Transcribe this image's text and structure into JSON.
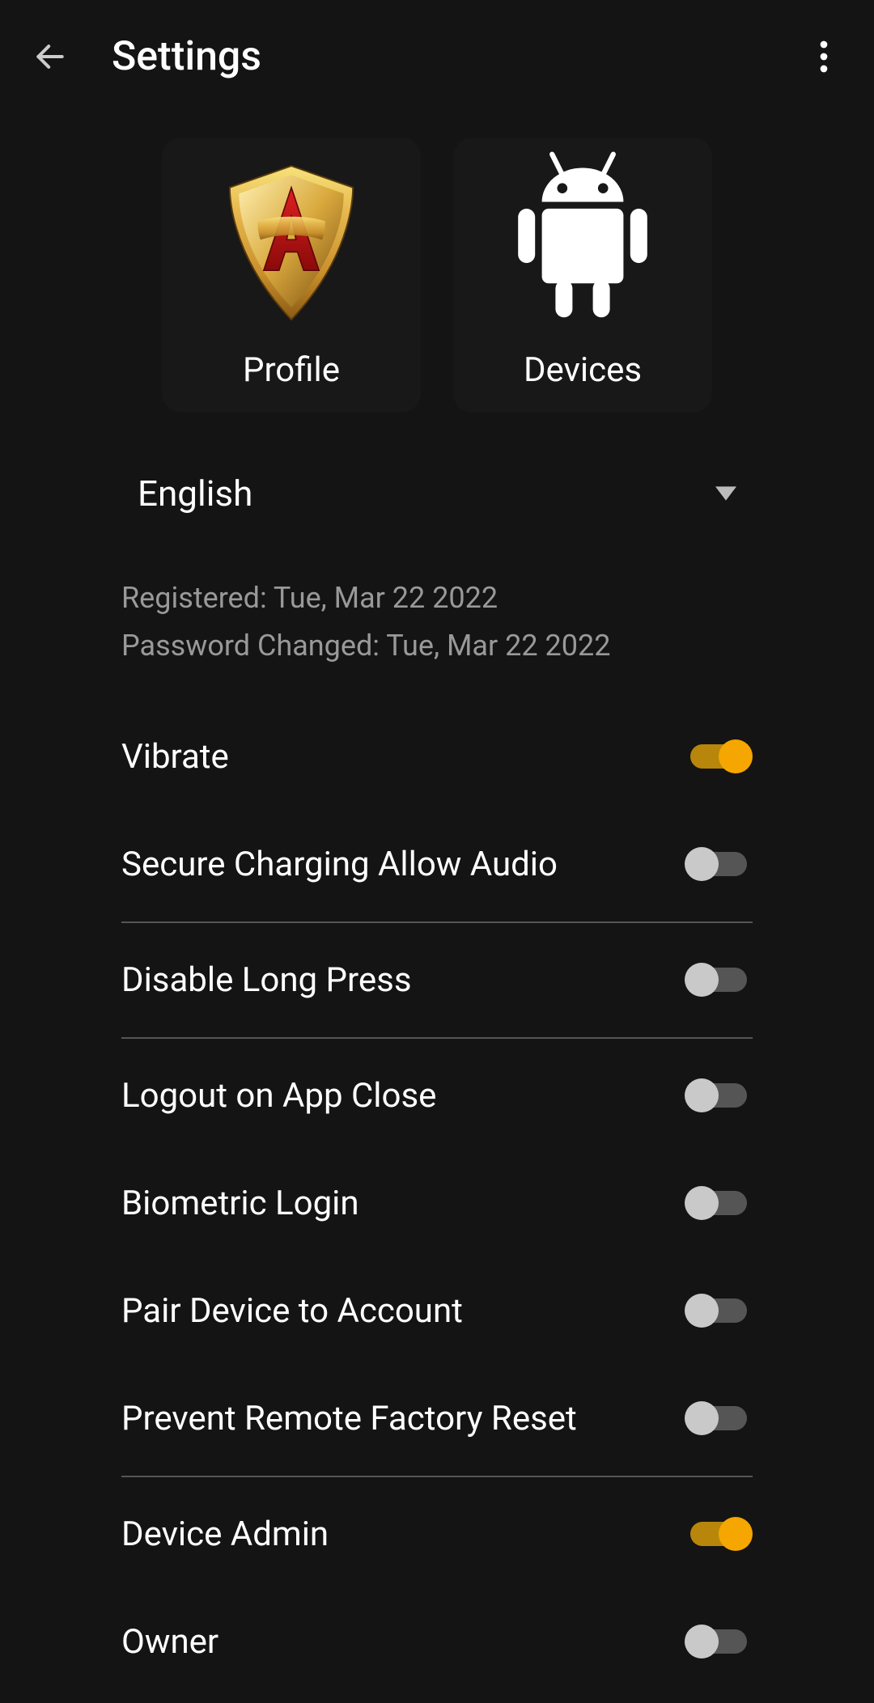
{
  "header": {
    "title": "Settings"
  },
  "cards": {
    "profile": "Profile",
    "devices": "Devices"
  },
  "language": {
    "selected": "English"
  },
  "info": {
    "registered_label": "Registered: ",
    "registered_value": "Tue, Mar 22 2022",
    "password_label": "Password Changed: ",
    "password_value": "Tue, Mar 22 2022"
  },
  "settings": {
    "vibrate": {
      "label": "Vibrate",
      "on": true
    },
    "secure_audio": {
      "label": "Secure Charging Allow Audio",
      "on": false
    },
    "disable_long_press": {
      "label": "Disable Long Press",
      "on": false
    },
    "logout_close": {
      "label": "Logout on App Close",
      "on": false
    },
    "biometric": {
      "label": "Biometric Login",
      "on": false
    },
    "pair_device": {
      "label": "Pair Device to Account",
      "on": false
    },
    "prevent_reset": {
      "label": "Prevent Remote Factory Reset",
      "on": false
    },
    "device_admin": {
      "label": "Device Admin",
      "on": true
    },
    "owner": {
      "label": "Owner",
      "on": false
    }
  },
  "colors": {
    "accent": "#f5a600",
    "accent_track": "#b8860b",
    "bg": "#141414",
    "text_muted": "#999"
  }
}
